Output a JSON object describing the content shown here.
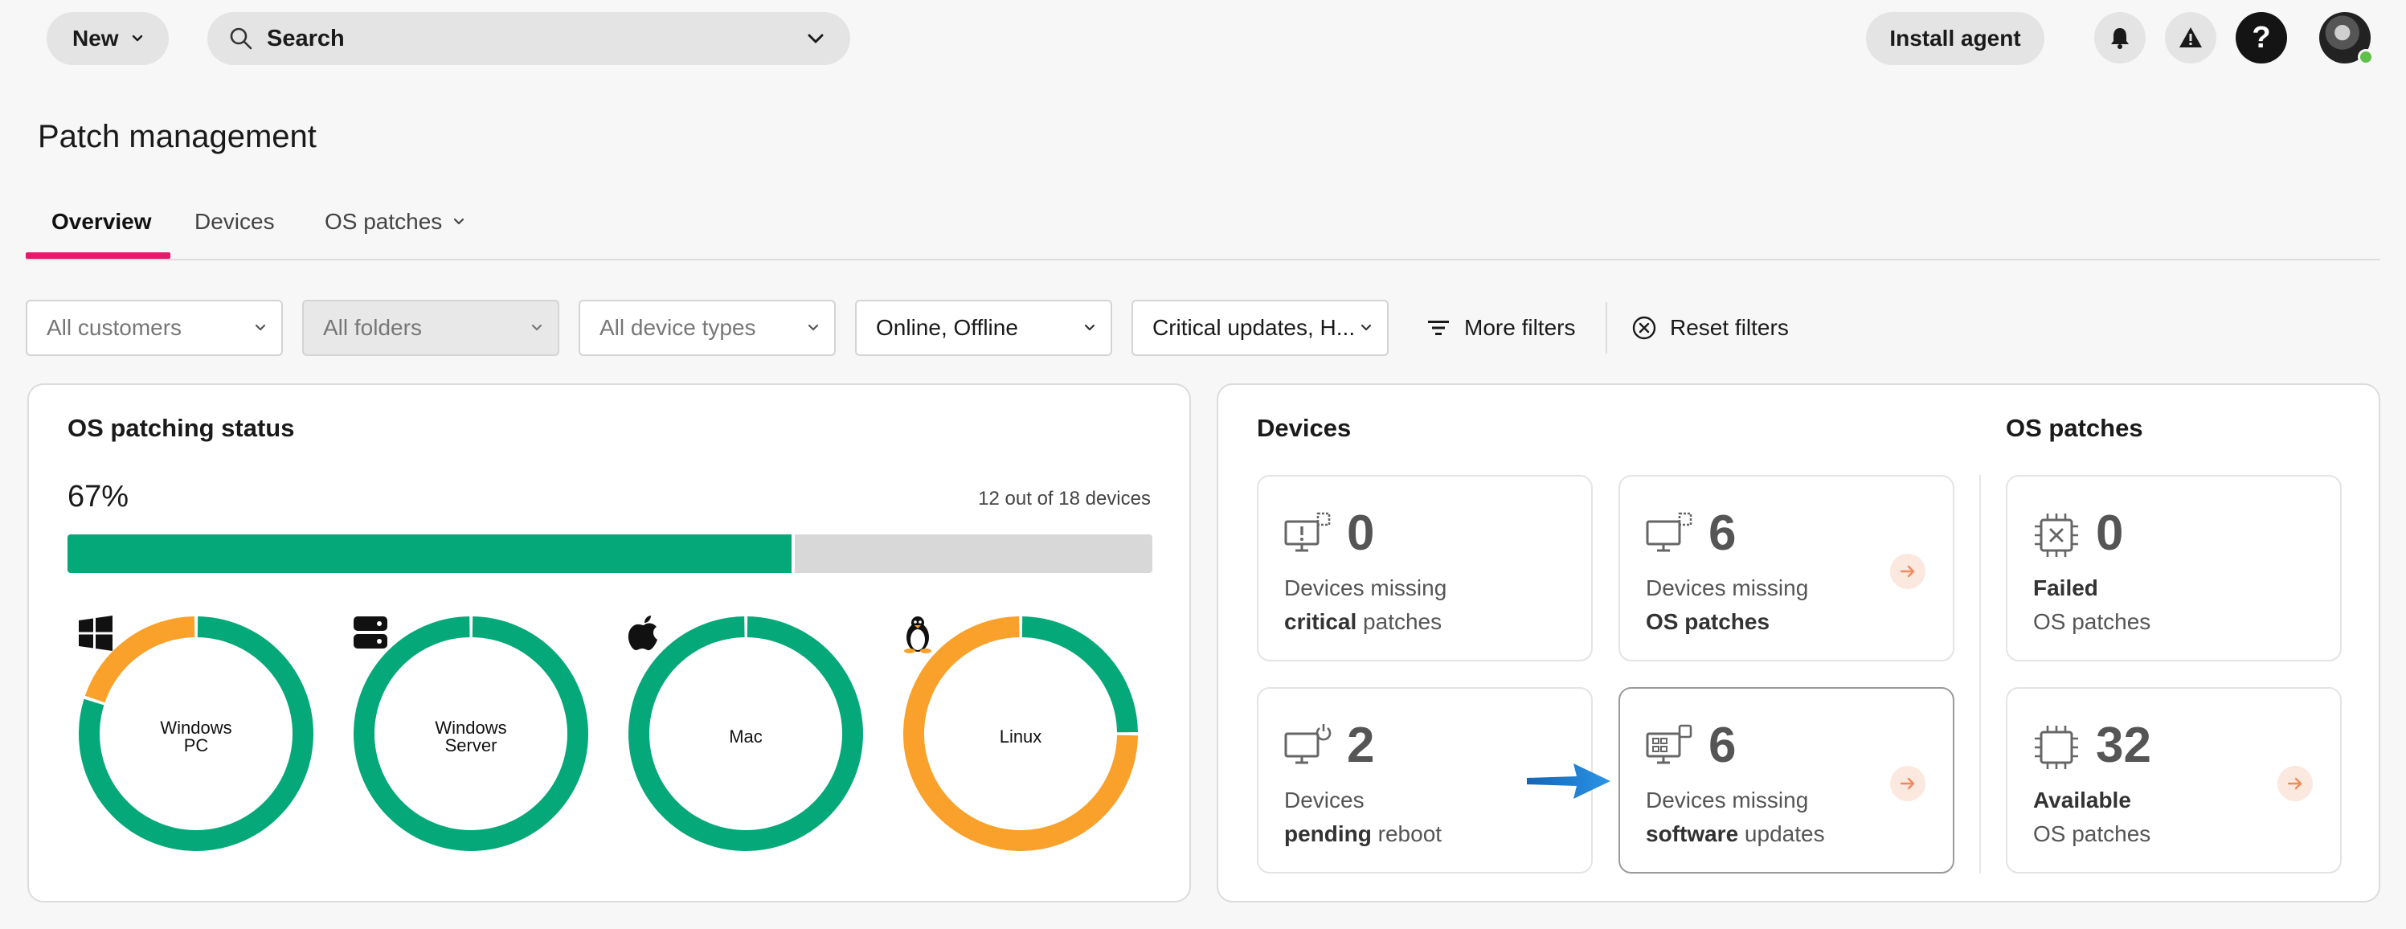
{
  "topbar": {
    "new_label": "New",
    "search_label": "Search",
    "install_label": "Install agent",
    "help_glyph": "?"
  },
  "page": {
    "title": "Patch management"
  },
  "tabs": [
    {
      "label": "Overview",
      "active": true
    },
    {
      "label": "Devices",
      "active": false
    },
    {
      "label": "OS patches",
      "active": false
    }
  ],
  "filters": [
    {
      "label": "All customers",
      "state": "placeholder"
    },
    {
      "label": "All folders",
      "state": "disabled"
    },
    {
      "label": "All device types",
      "state": "placeholder"
    },
    {
      "label": "Online, Offline",
      "state": "selected"
    },
    {
      "label": "Critical updates, H...",
      "state": "selected"
    }
  ],
  "more_filters_label": "More filters",
  "reset_filters_label": "Reset filters",
  "status_card": {
    "title": "OS patching status",
    "percent_label": "67%",
    "percent": 67,
    "devices_label": "12 out of 18 devices",
    "donuts": [
      {
        "label_line1": "Windows",
        "label_line2": "PC",
        "icon": "windows-icon",
        "patched_fraction": 0.8
      },
      {
        "label_line1": "Windows",
        "label_line2": "Server",
        "icon": "server-icon",
        "patched_fraction": 1.0
      },
      {
        "label_line1": "Mac",
        "label_line2": "",
        "icon": "apple-icon",
        "patched_fraction": 1.0
      },
      {
        "label_line1": "Linux",
        "label_line2": "",
        "icon": "linux-icon",
        "patched_fraction": 0.25
      }
    ]
  },
  "devices_section": {
    "title": "Devices",
    "tiles": [
      {
        "number": "0",
        "line1": "Devices missing",
        "bold": "critical",
        "rest": " patches",
        "icon": "monitor-alert-icon",
        "arrow": false
      },
      {
        "number": "6",
        "line1": "Devices missing",
        "bold": "OS patches",
        "rest": "",
        "icon": "monitor-patch-icon",
        "arrow": true
      },
      {
        "number": "2",
        "line1": "Devices",
        "bold": "pending",
        "rest": " reboot",
        "icon": "monitor-power-icon",
        "arrow": false
      },
      {
        "number": "6",
        "line1": "Devices missing",
        "bold": "software",
        "rest": " updates",
        "icon": "monitor-apps-icon",
        "arrow": true
      }
    ]
  },
  "os_patches_section": {
    "title": "OS patches",
    "tiles": [
      {
        "number": "0",
        "bold": "Failed",
        "line2": "OS patches",
        "icon": "chip-failed-icon",
        "arrow": false
      },
      {
        "number": "32",
        "bold": "Available",
        "line2": "OS patches",
        "icon": "chip-icon",
        "arrow": true
      }
    ]
  },
  "colors": {
    "patched": "#05a878",
    "unpatched": "#f9a12b",
    "accent": "#e8186d",
    "arrow": "#f28a5b",
    "callout": "#1a7fd0"
  }
}
